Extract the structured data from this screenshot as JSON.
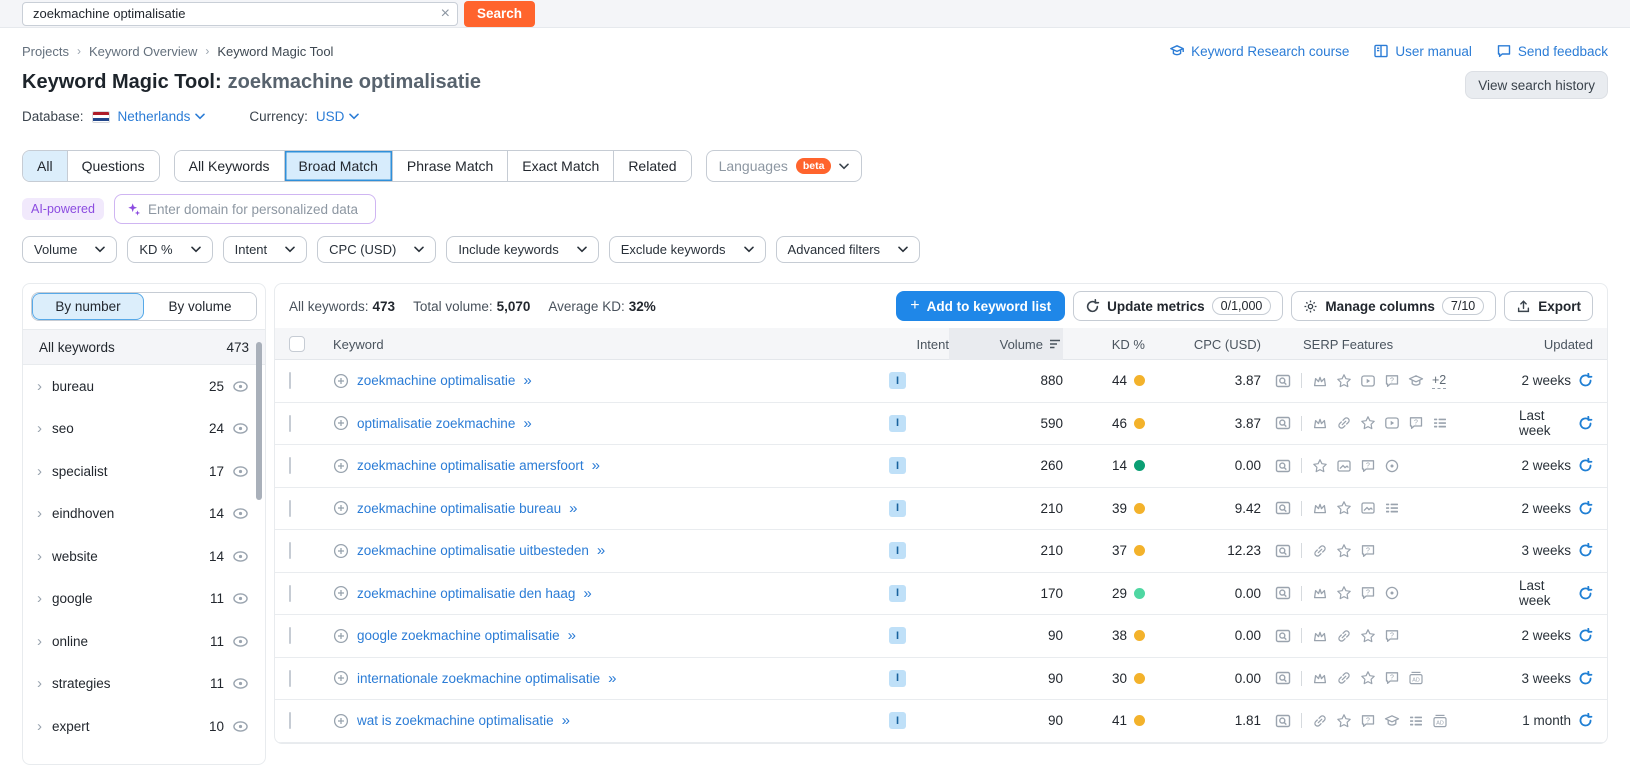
{
  "topbar": {
    "search_value": "zoekmachine optimalisatie",
    "search_button": "Search",
    "clear_icon": "close-icon"
  },
  "header": {
    "breadcrumb": [
      "Projects",
      "Keyword Overview",
      "Keyword Magic Tool"
    ],
    "links": [
      {
        "icon": "course-icon",
        "label": "Keyword Research course"
      },
      {
        "icon": "manual-icon",
        "label": "User manual"
      },
      {
        "icon": "feedback-icon",
        "label": "Send feedback"
      }
    ],
    "title": "Keyword Magic Tool:",
    "title_query": "zoekmachine optimalisatie",
    "view_history": "View search history",
    "database_label": "Database:",
    "database_value": "Netherlands",
    "currency_label": "Currency:",
    "currency_value": "USD"
  },
  "tabs": {
    "group1": [
      {
        "label": "All",
        "selected": true
      },
      {
        "label": "Questions",
        "selected": false
      }
    ],
    "group2": [
      {
        "label": "All Keywords",
        "selected": false
      },
      {
        "label": "Broad Match",
        "selected": true
      },
      {
        "label": "Phrase Match",
        "selected": false
      },
      {
        "label": "Exact Match",
        "selected": false
      },
      {
        "label": "Related",
        "selected": false
      }
    ],
    "languages": {
      "label": "Languages",
      "badge": "beta"
    }
  },
  "ai": {
    "badge": "AI-powered",
    "sparkle_icon": "sparkle-icon",
    "placeholder": "Enter domain for personalized data"
  },
  "filters": [
    "Volume",
    "KD %",
    "Intent",
    "CPC (USD)",
    "Include keywords",
    "Exclude keywords",
    "Advanced filters"
  ],
  "sidebar": {
    "toggle": [
      {
        "label": "By number",
        "selected": true
      },
      {
        "label": "By volume",
        "selected": false
      }
    ],
    "all_label": "All keywords",
    "all_count": "473",
    "groups": [
      {
        "label": "bureau",
        "count": "25"
      },
      {
        "label": "seo",
        "count": "24"
      },
      {
        "label": "specialist",
        "count": "17"
      },
      {
        "label": "eindhoven",
        "count": "14"
      },
      {
        "label": "website",
        "count": "14"
      },
      {
        "label": "google",
        "count": "11"
      },
      {
        "label": "online",
        "count": "11"
      },
      {
        "label": "strategies",
        "count": "11"
      },
      {
        "label": "expert",
        "count": "10"
      }
    ]
  },
  "toolbar": {
    "stats": [
      {
        "label": "All keywords:",
        "value": "473"
      },
      {
        "label": "Total volume:",
        "value": "5,070"
      },
      {
        "label": "Average KD:",
        "value": "32%"
      }
    ],
    "add_button": "Add to keyword list",
    "update_button": "Update metrics",
    "update_badge": "0/1,000",
    "columns_button": "Manage columns",
    "columns_badge": "7/10",
    "export_button": "Export"
  },
  "table": {
    "headers": {
      "keyword": "Keyword",
      "intent": "Intent",
      "volume": "Volume",
      "kd": "KD %",
      "cpc": "CPC (USD)",
      "serp": "SERP Features",
      "updated": "Updated"
    },
    "rows": [
      {
        "keyword": "zoekmachine optimalisatie",
        "intent": "I",
        "volume": "880",
        "kd": "44",
        "kd_level": "yellow",
        "cpc": "3.87",
        "serp": [
          "crown",
          "star",
          "video",
          "faq",
          "education"
        ],
        "serp_more": "+2",
        "updated": "2 weeks"
      },
      {
        "keyword": "optimalisatie zoekmachine",
        "intent": "I",
        "volume": "590",
        "kd": "46",
        "kd_level": "yellow",
        "cpc": "3.87",
        "serp": [
          "crown",
          "link",
          "star",
          "video",
          "faq",
          "sitelinks"
        ],
        "serp_more": "",
        "updated": "Last week"
      },
      {
        "keyword": "zoekmachine optimalisatie amersfoort",
        "intent": "I",
        "volume": "260",
        "kd": "14",
        "kd_level": "green",
        "cpc": "0.00",
        "serp": [
          "star",
          "image",
          "faq",
          "location"
        ],
        "serp_more": "",
        "updated": "2 weeks"
      },
      {
        "keyword": "zoekmachine optimalisatie bureau",
        "intent": "I",
        "volume": "210",
        "kd": "39",
        "kd_level": "yellow",
        "cpc": "9.42",
        "serp": [
          "crown",
          "star",
          "image",
          "sitelinks"
        ],
        "serp_more": "",
        "updated": "2 weeks"
      },
      {
        "keyword": "zoekmachine optimalisatie uitbesteden",
        "intent": "I",
        "volume": "210",
        "kd": "37",
        "kd_level": "yellow",
        "cpc": "12.23",
        "serp": [
          "link",
          "star",
          "faq"
        ],
        "serp_more": "",
        "updated": "3 weeks"
      },
      {
        "keyword": "zoekmachine optimalisatie den haag",
        "intent": "I",
        "volume": "170",
        "kd": "29",
        "kd_level": "lightgreen",
        "cpc": "0.00",
        "serp": [
          "crown",
          "star",
          "faq",
          "location"
        ],
        "serp_more": "",
        "updated": "Last week"
      },
      {
        "keyword": "google zoekmachine optimalisatie",
        "intent": "I",
        "volume": "90",
        "kd": "38",
        "kd_level": "yellow",
        "cpc": "0.00",
        "serp": [
          "crown",
          "link",
          "star",
          "faq"
        ],
        "serp_more": "",
        "updated": "2 weeks"
      },
      {
        "keyword": "internationale zoekmachine optimalisatie",
        "intent": "I",
        "volume": "90",
        "kd": "30",
        "kd_level": "yellow",
        "cpc": "0.00",
        "serp": [
          "crown",
          "link",
          "star",
          "faq",
          "ads"
        ],
        "serp_more": "",
        "updated": "3 weeks"
      },
      {
        "keyword": "wat is zoekmachine optimalisatie",
        "intent": "I",
        "volume": "90",
        "kd": "41",
        "kd_level": "yellow",
        "cpc": "1.81",
        "serp": [
          "link",
          "star",
          "faq",
          "education",
          "sitelinks",
          "ads"
        ],
        "serp_more": "",
        "updated": "1 month"
      }
    ]
  },
  "colors": {
    "accent_orange": "#ff642d",
    "link_blue": "#2b7cd6",
    "button_blue": "#1f87e8",
    "kd_yellow": "#f3b22b",
    "kd_green": "#0b9f74",
    "kd_lightgreen": "#4fd7a2",
    "intent_bg": "#bfe0f8",
    "intent_text": "#19639e"
  }
}
